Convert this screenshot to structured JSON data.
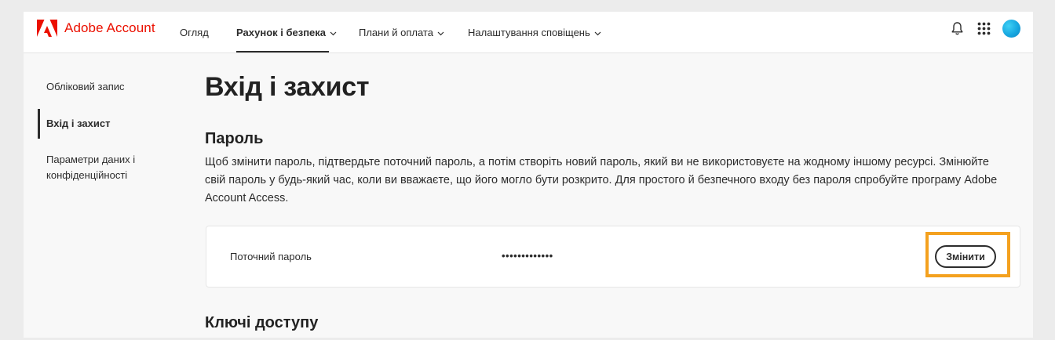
{
  "header": {
    "brand": "Adobe Account",
    "nav": [
      {
        "label": "Огляд"
      },
      {
        "label": "Рахунок і безпека"
      },
      {
        "label": "Плани й оплата"
      },
      {
        "label": "Налаштування сповіщень"
      }
    ],
    "icons": [
      "bell-icon",
      "apps-grid-icon",
      "avatar"
    ],
    "accent_color": "#eb1000"
  },
  "sidebar": {
    "items": [
      {
        "label": "Обліковий запис"
      },
      {
        "label": "Вхід і захист"
      },
      {
        "label": "Параметри даних і конфіденційності"
      }
    ]
  },
  "main": {
    "title": "Вхід і захист",
    "password_section": {
      "heading": "Пароль",
      "description": "Щоб змінити пароль, підтвердьте поточний пароль, а потім створіть новий пароль, який ви не використовуєте на жодному іншому ресурсі. Змінюйте свій пароль у будь-який час, коли ви вважаєте, що його могло бути розкрито. Для простого й безпечного входу без пароля спробуйте програму Adobe Account Access.",
      "current_label": "Поточний пароль",
      "current_value": "•••••••••••••",
      "change_button": "Змінити",
      "highlight_color": "#f4a11f"
    },
    "passkeys_section": {
      "heading": "Ключі доступу"
    }
  }
}
